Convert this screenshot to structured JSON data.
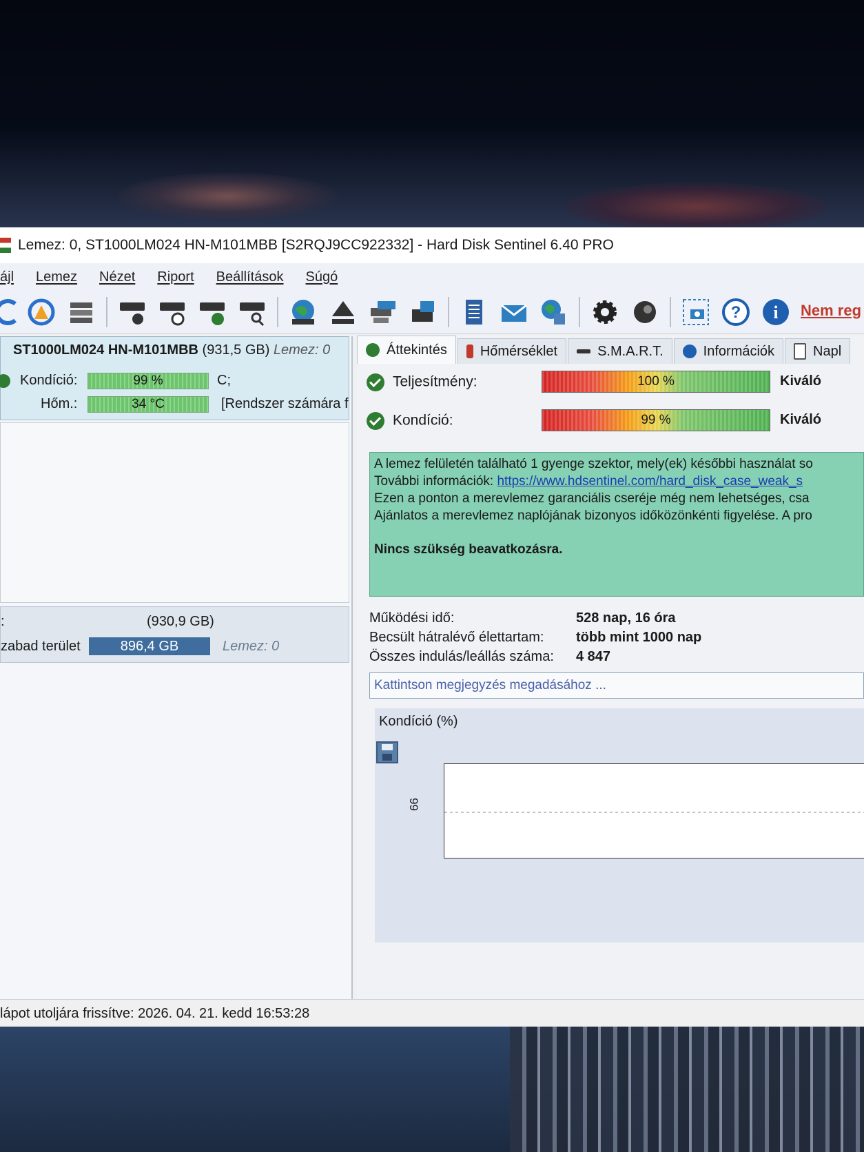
{
  "window": {
    "title": "Lemez: 0, ST1000LM024 HN-M101MBB [S2RQJ9CC922332]  -  Hard Disk Sentinel 6.40 PRO"
  },
  "menu": [
    "ájl",
    "Lemez",
    "Nézet",
    "Riport",
    "Beállítások",
    "Súgó"
  ],
  "toolbar": {
    "icons": [
      "refresh-icon",
      "refresh-warning-icon",
      "disk-list-icon",
      "disk-test-icon",
      "disk-schedule-icon",
      "disk-check-icon",
      "disk-search-icon",
      "network-globe-icon",
      "eject-icon",
      "transfer-icon",
      "backup-icon",
      "report-icon",
      "email-icon",
      "web-report-icon",
      "settings-gear-icon",
      "sound-icon",
      "screenshot-icon",
      "help-icon",
      "info-icon"
    ],
    "register_link": "Nem reg"
  },
  "left": {
    "disk_name": "ST1000LM024 HN-M101MBB",
    "disk_size": "(931,5 GB)",
    "disk_label": "Lemez: 0",
    "condition_label": "Kondíció:",
    "condition_value": "99 %",
    "condition_drive": "C;",
    "temp_label": "Hőm.:",
    "temp_value": "34 °C",
    "temp_note": "[Rendszer számára f",
    "partition_size": "(930,9 GB)",
    "partition_prefix": ":",
    "free_label": "zabad terület",
    "free_value": "896,4 GB",
    "partition_disk": "Lemez: 0"
  },
  "tabs": [
    "Áttekintés",
    "Hőmérséklet",
    "S.M.A.R.T.",
    "Információk",
    "Napl"
  ],
  "overview": {
    "performance_label": "Teljesítmény:",
    "performance_value": "100 %",
    "performance_rating": "Kiváló",
    "condition_label": "Kondíció:",
    "condition_value": "99 %",
    "condition_rating": "Kiváló",
    "info_lines": [
      "A lemez felületén található 1 gyenge szektor, mely(ek) későbbi használat so",
      "További információk: ",
      "Ezen a ponton a merevlemez garanciális cseréje még nem lehetséges, csa",
      "Ajánlatos a merevlemez naplójának bizonyos időközönkénti figyelése. A pro"
    ],
    "info_link": "https://www.hdsentinel.com/hard_disk_case_weak_s",
    "info_action": "Nincs szükség beavatkozásra.",
    "uptime_label": "Működési idő:",
    "uptime_value": "528 nap, 16 óra",
    "lifetime_label": "Becsült hátralévő élettartam:",
    "lifetime_value": "több mint 1000 nap",
    "starts_label": "Összes indulás/leállás száma:",
    "starts_value": "4 847",
    "note_placeholder": "Kattintson megjegyzés megadásához ...",
    "chart_title": "Kondíció  (%)",
    "chart_ytick": "99"
  },
  "status_bar": "lápot utoljára frissítve: 2026. 04. 21. kedd 16:53:28"
}
